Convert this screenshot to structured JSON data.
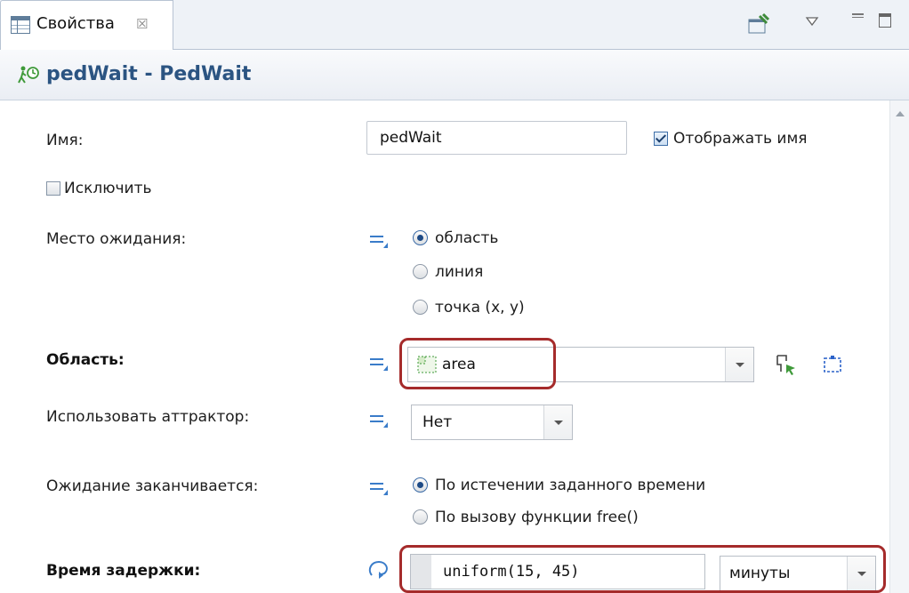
{
  "tab": {
    "label": "Свойства",
    "close_glyph": "☒"
  },
  "header": {
    "title": "pedWait - PedWait"
  },
  "fields": {
    "name_label": "Имя:",
    "name_value": "pedWait",
    "show_name_label": "Отображать имя",
    "show_name_checked": true,
    "exclude_label": "Исключить",
    "exclude_checked": false,
    "wait_place_label": "Место ожидания:",
    "wait_place_options": [
      "область",
      "линия",
      "точка (x, y)"
    ],
    "wait_place_selected": "область",
    "area_label": "Область:",
    "area_value": "area",
    "attractor_label": "Использовать аттрактор:",
    "attractor_value": "Нет",
    "wait_end_label": "Ожидание заканчивается:",
    "wait_end_options": [
      "По истечении заданного времени",
      "По вызову функции free()"
    ],
    "wait_end_selected": "По истечении заданного времени",
    "delay_label": "Время задержки:",
    "delay_value": "uniform(15, 45)",
    "delay_unit": "минуты"
  },
  "icons": {
    "tab": "properties-table-icon",
    "toolbar": [
      "pin-icon",
      "view-menu-icon",
      "minimize-icon",
      "maximize-icon"
    ],
    "title": "ped-wait-block-icon",
    "area": [
      "area-shape-icon",
      "select-on-canvas-icon",
      "area-marquee-icon"
    ],
    "delay": "dynamic-value-icon"
  },
  "colors": {
    "title": "#2b5482",
    "highlight": "#a52b2b",
    "accent": "#3a7cc9"
  }
}
